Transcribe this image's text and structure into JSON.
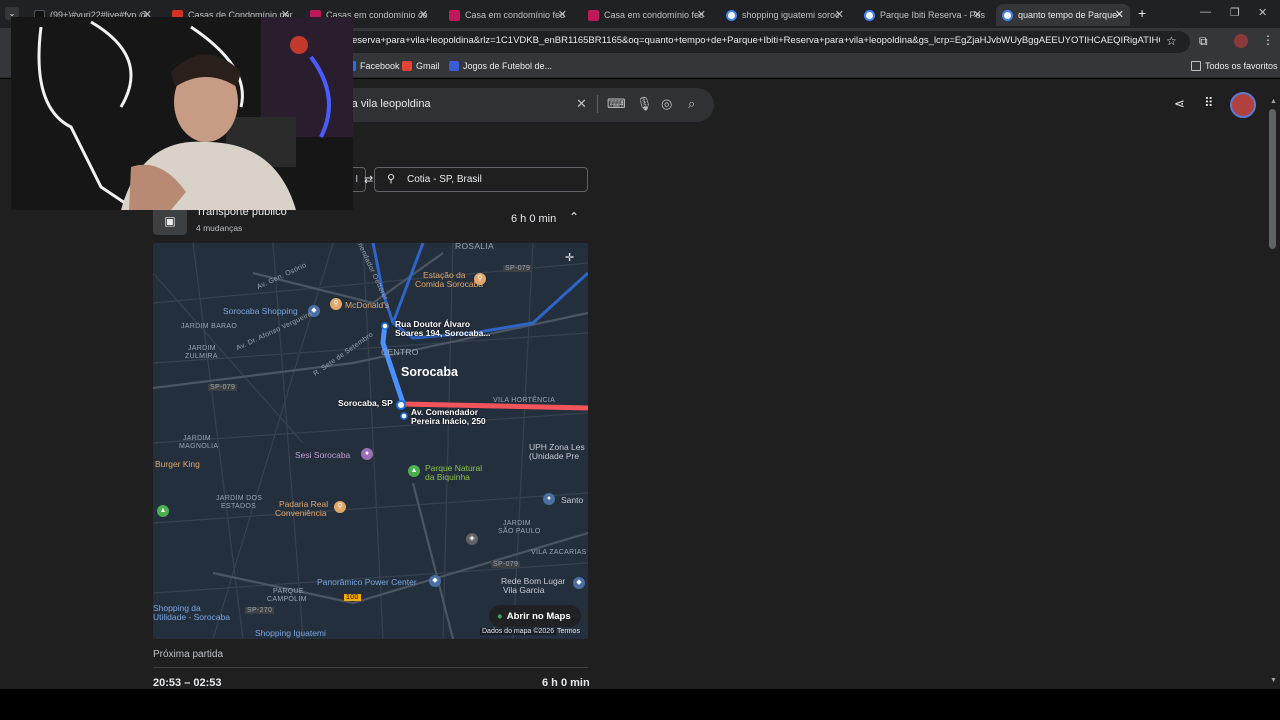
{
  "browser": {
    "tabs": [
      {
        "title": "(99+)#yuri22#live#fyp @",
        "color": "#111111"
      },
      {
        "title": "Casas de Condomínio par",
        "color": "#d93025"
      },
      {
        "title": "Casas em condomínio co",
        "color": "#c2185b"
      },
      {
        "title": "Casa em condomínio fec",
        "color": "#c2185b"
      },
      {
        "title": "Casa em condomínio fec",
        "color": "#c2185b"
      },
      {
        "title": "shopping iguatemi soroc",
        "color": "#4285f4"
      },
      {
        "title": "Parque Ibiti Reserva - Pes",
        "color": "#4285f4"
      },
      {
        "title": "quanto tempo de Parque",
        "color": "#4285f4"
      }
    ],
    "new_tab": "+",
    "url": "eserva+para+vila+leopoldina&rlz=1C1VDKB_enBR1165BR1165&oq=quanto+tempo+de+Parque+Ibiti+Reserva+para+vila+leopoldina&gs_lcrp=EgZjaHJvbWUyBggAEEUYOTIHCAEQIRigATIHCAIQ...",
    "bookmarks": [
      {
        "label": "Facebook",
        "color": "#1877f2"
      },
      {
        "label": "Gmail",
        "color": "#ea4335"
      },
      {
        "label": "Jogos de Futebol de...",
        "color": "#3b5bdb"
      }
    ],
    "all_bookmarks": "Todos os favoritos"
  },
  "search": {
    "query": "ra vila leopoldina"
  },
  "directions": {
    "destination": "Cotia - SP, Brasil",
    "origin_partial": "e I",
    "mode_title": "Transporte público",
    "changes": "4 mudanças",
    "duration": "6 h 0 min"
  },
  "map": {
    "labels": {
      "rosalia": "ROSALIA",
      "estacao": "Estação da",
      "estacao2": "Comida Sorocaba",
      "mcdonalds": "McDonald's",
      "sorocaba_shopping": "Sorocaba Shopping",
      "jardim_barao": "JARDIM BARAO",
      "av_gen_osorio": "Av. Gen. Osório",
      "comendador": "Comendador Oetterer",
      "rua_alvaro1": "Rua Doutor Álvaro",
      "rua_alvaro2": "Soares 194, Sorocaba...",
      "centro": "CENTRO",
      "city": "Sorocaba",
      "jardim_zulmira1": "JARDIM",
      "jardim_zulmira2": "ZULMIRA",
      "av_afonso": "Av. Dr. Afonso Vergueiro",
      "r_7set": "R. Sete de Setembro",
      "sp079": "SP-079",
      "sp079b": "SP-079",
      "sorocaba_sp": "Sorocaba, SP",
      "av_comendador1": "Av. Comendador",
      "av_comendador2": "Pereira Inácio, 250",
      "vila_hortencia": "VILA HORTÊNCIA",
      "jardim_magnolia1": "JARDIM",
      "jardim_magnolia2": "MAGNOLIA",
      "burger_king": "Burger King",
      "sesi": "Sesi Sorocaba",
      "upa1": "UPH Zona Les",
      "upa2": "(Unidade Pre",
      "parque1": "Parque Natural",
      "parque2": "da Biquinha",
      "jardim_dos1": "JARDIM DOS",
      "jardim_dos2": "ESTADOS",
      "padaria1": "Padaria Real",
      "padaria2": "Conveniência",
      "santo": "Santo",
      "jardim_sp1": "JARDIM",
      "jardim_sp2": "SÃO PAULO",
      "vila_zacarias": "VILA ZACARIAS",
      "panoramico": "Panorâmico Power Center",
      "rede_bom1": "Rede Bom Lugar",
      "rede_bom2": "Vila Garcia",
      "parque_campolim1": "PARQUE",
      "parque_campolim2": "CAMPOLIM",
      "shopping_util1": "Shopping da",
      "shopping_util2": "Utilidade - Sorocaba",
      "shopping_iguatemi": "Shopping Iguatemi",
      "sp270": "SP-270",
      "r100": "100",
      "sp079c": "SP-079"
    },
    "open_in_maps": "Abrir no Maps",
    "attribution": "Dados do mapa ©2026",
    "terms": "Termos",
    "route_color": "#4a90ff",
    "walk_color": "#f2545b"
  },
  "next_departure": {
    "label": "Próxima partida",
    "times": "20:53 – 02:53",
    "duration": "6 h 0 min"
  }
}
